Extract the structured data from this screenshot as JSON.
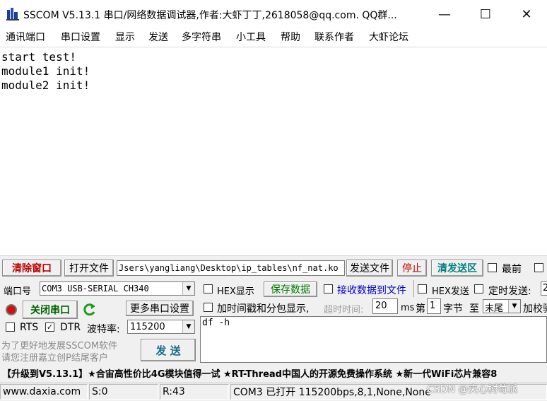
{
  "window": {
    "title": "SSCOM V5.13.1 串口/网络数据调试器,作者:大虾丁丁,2618058@qq.com. QQ群...",
    "min_label": "—",
    "max_label": "☐",
    "close_label": "✕"
  },
  "menu": {
    "items": [
      "通讯端口",
      "串口设置",
      "显示",
      "发送",
      "多字符串",
      "小工具",
      "帮助",
      "联系作者",
      "大虾论坛"
    ]
  },
  "receive": {
    "text": "start test!\nmodule1 init!\nmodule2 init!"
  },
  "toolbar": {
    "clear_window": "清除窗口",
    "open_file": "打开文件",
    "file_path": "Jsers\\yangliang\\Desktop\\ip_tables\\nf_nat.ko",
    "send_file": "发送文件",
    "stop": "停止",
    "clear_send": "清发送区",
    "topmost_label": "最前"
  },
  "port": {
    "port_label": "端口号",
    "port_value": "COM3 USB-SERIAL CH340",
    "close_port": "关闭串口",
    "more_settings": "更多串口设置",
    "rts_label": "RTS",
    "dtr_label": "DTR",
    "rts_checked": false,
    "dtr_checked": true,
    "baud_label": "波特率:",
    "baud_value": "115200"
  },
  "options": {
    "hex_display": "HEX显示",
    "save_data": "保存数据",
    "recv_to_file": "接收数据到文件",
    "hex_send": "HEX发送",
    "timed_send": "定时发送:",
    "timed_value": "2",
    "timestamp": "加时间戳和分包显示,",
    "timeout_label": "超时时间:",
    "timeout_value": "20",
    "ms": "ms",
    "nth": "第",
    "byte_value": "1",
    "byte_label": "字节",
    "to": "至",
    "tail_value": "末尾",
    "checksum": "加校验"
  },
  "send": {
    "text": "df -h",
    "send_button": "发 送"
  },
  "promo": {
    "line1": "为了更好地发展SSCOM软件",
    "line2": "请您注册嘉立创P结尾客户"
  },
  "ticker": {
    "text": "【升级到V5.13.1】★合宙高性价比4G模块值得一试 ★RT-Thread中国人的开源免费操作系统 ★新一代WiFi芯片兼容8"
  },
  "status": {
    "website": "www.daxia.com",
    "sent": "S:0",
    "received": "R:43",
    "port_state": "COM3 已打开  115200bps,8,1,None,None",
    "watermark": "CSDN @夹心树莓派"
  },
  "colors": {
    "clear_red": "#c00000",
    "clear_send_teal": "#008080",
    "save_green": "#007a00",
    "recv_file_blue": "#0000c0",
    "close_port_green": "#006000",
    "send_teal": "#1a6e8a",
    "record_red": "#d01010"
  }
}
